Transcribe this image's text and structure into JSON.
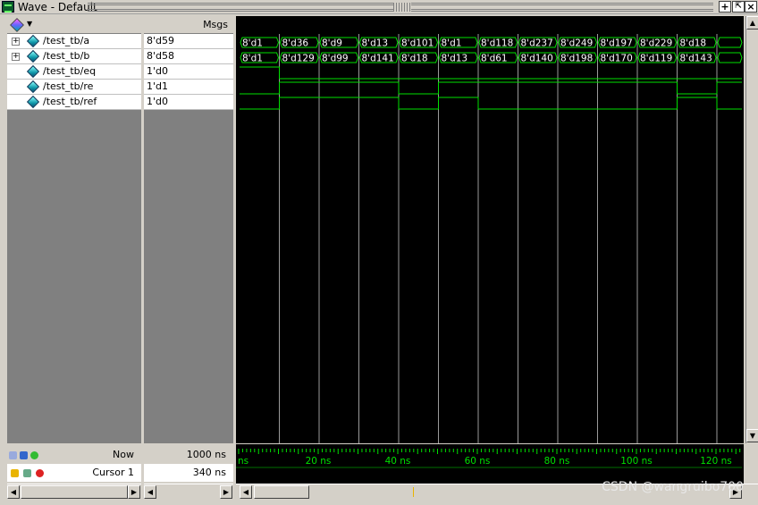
{
  "window": {
    "title": "Wave - Default"
  },
  "header": {
    "msgs_label": "Msgs"
  },
  "signals": [
    {
      "name": "/test_tb/a",
      "value": "8'd59",
      "bus": true
    },
    {
      "name": "/test_tb/b",
      "value": "8'd58",
      "bus": true
    },
    {
      "name": "/test_tb/eq",
      "value": "1'd0",
      "bus": false
    },
    {
      "name": "/test_tb/re",
      "value": "1'd1",
      "bus": false
    },
    {
      "name": "/test_tb/ref",
      "value": "1'd0",
      "bus": false
    }
  ],
  "waves": {
    "a": [
      "8'd1",
      "8'd36",
      "8'd9",
      "8'd13",
      "8'd101",
      "8'd1",
      "8'd118",
      "8'd237",
      "8'd249",
      "8'd197",
      "8'd229",
      "8'd18",
      ""
    ],
    "b": [
      "8'd1",
      "8'd129",
      "8'd99",
      "8'd141",
      "8'd18",
      "8'd13",
      "8'd61",
      "8'd140",
      "8'd198",
      "8'd170",
      "8'd119",
      "8'd143",
      ""
    ],
    "eq": [
      1,
      0,
      0,
      0,
      0,
      0,
      0,
      0,
      0,
      0,
      0,
      0,
      0
    ],
    "re": [
      0,
      1,
      1,
      1,
      0,
      1,
      1,
      1,
      1,
      1,
      1,
      0,
      1
    ],
    "ref": [
      0,
      1,
      1,
      1,
      0,
      1,
      0,
      0,
      0,
      0,
      0,
      1,
      0
    ]
  },
  "status": {
    "now_label": "Now",
    "now_value": "1000 ns",
    "cursor_label": "Cursor 1",
    "cursor_value": "340 ns"
  },
  "timeline": {
    "first_label": "ns",
    "labels": [
      "20 ns",
      "40 ns",
      "60 ns",
      "80 ns",
      "100 ns",
      "120 ns"
    ]
  },
  "colors": {
    "wave": "#00e000",
    "grid": "#9a9a9a",
    "background": "#000000"
  },
  "watermark": "CSDN @wangruibo700"
}
